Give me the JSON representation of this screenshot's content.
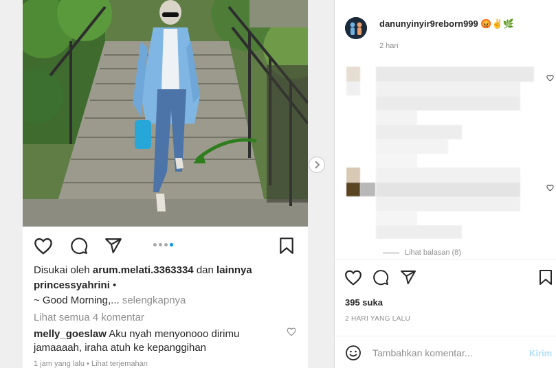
{
  "feed_post": {
    "liked_by_prefix": "Disukai oleh ",
    "liked_by_user": "arum.melati.3363334",
    "liked_by_and": " dan ",
    "liked_by_others": "lainnya",
    "caption_user": "princessyahrini",
    "caption_sep": " •",
    "caption_text": "~ Good Morning,...",
    "caption_more": " selengkapnya",
    "view_comments": "Lihat semua 4 komentar",
    "comment_user": "melly_goeslaw",
    "comment_text_1": " Aku nyah menyonooo dirimu",
    "comment_text_2": "jamaaaah, iraha atuh ke kepanggihan",
    "comment_time": "1 jam yang lalu",
    "comment_sep": " • ",
    "comment_translate": "Lihat terjemahan",
    "carousel_total": 4,
    "carousel_active": 3
  },
  "detail": {
    "username": "danunyinyir9reborn999 😡✌🌿",
    "posted_ago": "2 hari",
    "view_replies": "Lihat balasan (8)",
    "likes": "395 suka",
    "timestamp": "2 HARI YANG LALU",
    "comment_placeholder": "Tambahkan komentar...",
    "post_label": "Kirim"
  },
  "colors": {
    "accent": "#0095f6",
    "post_disabled": "#b2dffc",
    "muted_text": "#8e8e8e",
    "arrow_annotation": "#2e7d1e"
  },
  "icons": [
    "heart-icon",
    "comment-icon",
    "share-icon",
    "bookmark-icon",
    "chevron-right-icon",
    "emoji-icon"
  ]
}
